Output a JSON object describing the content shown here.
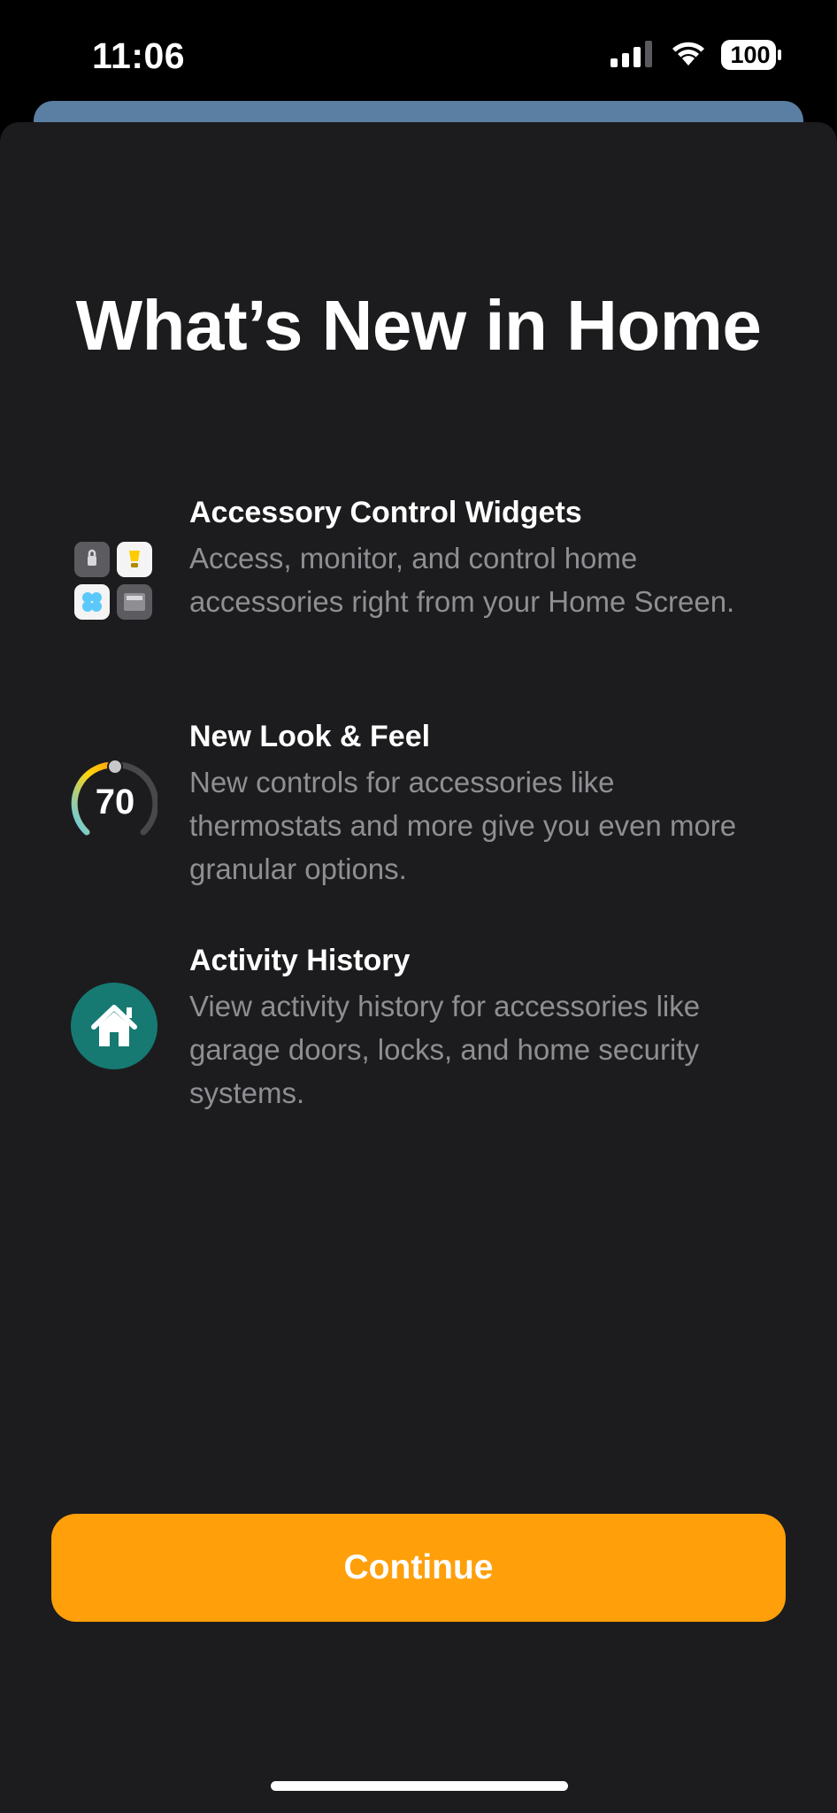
{
  "status_bar": {
    "time": "11:06",
    "battery": "100",
    "icons": [
      "signal-icon",
      "wifi-icon",
      "battery-icon"
    ]
  },
  "sheet": {
    "title": "What’s New in Home",
    "features": [
      {
        "icon": "widgets-icon",
        "title": "Accessory Control Widgets",
        "description": "Access, monitor, and control home accessories right from your Home Screen."
      },
      {
        "icon": "thermostat-icon",
        "icon_value": "70",
        "title": "New Look & Feel",
        "description": "New controls for accessories like thermostats and more give you even more granular options."
      },
      {
        "icon": "home-icon",
        "title": "Activity History",
        "description": "View activity history for accessories like garage doors, locks, and home security systems."
      }
    ],
    "continue_label": "Continue"
  },
  "colors": {
    "accent": "#ff9f0a",
    "sheet_bg": "#1c1c1e",
    "secondary_text": "#8e8e93",
    "home_icon_bg": "#167a73"
  }
}
